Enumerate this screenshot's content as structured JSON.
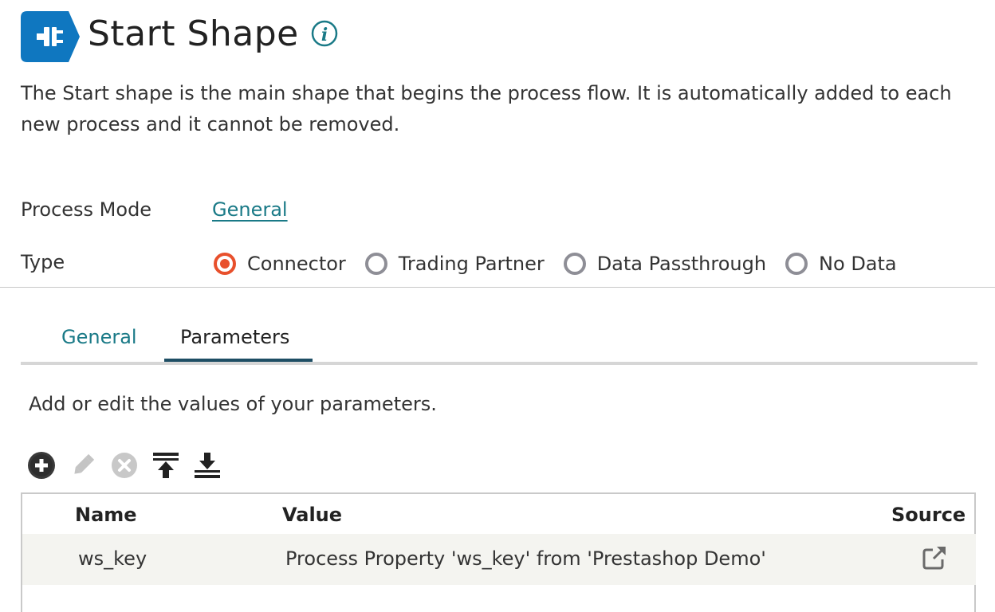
{
  "header": {
    "title": "Start Shape",
    "icon": "start-shape-plug-icon",
    "info_icon": "info-icon",
    "accent_color": "#0f77c0"
  },
  "description": "The Start shape is the main shape that begins the process flow. It is automatically added to each new process and it cannot be removed.",
  "process_mode": {
    "label": "Process Mode",
    "value": "General"
  },
  "type": {
    "label": "Type",
    "selected": "Connector",
    "options": [
      "Connector",
      "Trading Partner",
      "Data Passthrough",
      "No Data"
    ]
  },
  "tabs": [
    {
      "label": "General",
      "active": false
    },
    {
      "label": "Parameters",
      "active": true
    }
  ],
  "parameters": {
    "helper": "Add or edit the values of your parameters.",
    "toolbar": [
      "add-icon",
      "edit-icon",
      "remove-icon",
      "move-to-top-icon",
      "move-to-bottom-icon"
    ],
    "columns": [
      "Name",
      "Value",
      "Source"
    ],
    "rows": [
      {
        "name": "ws_key",
        "value": "Process Property 'ws_key' from 'Prestashop Demo'",
        "source_icon": "external-link-icon"
      }
    ]
  }
}
